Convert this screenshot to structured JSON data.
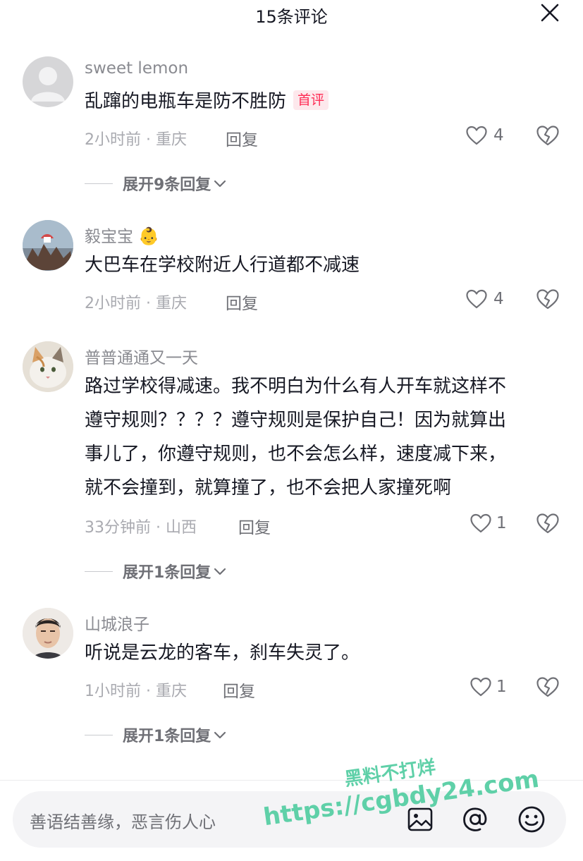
{
  "header": {
    "title": "15条评论"
  },
  "comments": [
    {
      "username": "sweet lemon",
      "text": "乱蹿的电瓶车是防不胜防",
      "badge": "首评",
      "time": "2小时前 · 重庆",
      "reply_label": "回复",
      "likes": "4",
      "expand_label": "展开9条回复"
    },
    {
      "username": "毅宝宝",
      "user_emoji": "👶",
      "text": "大巴车在学校附近人行道都不减速",
      "time": "2小时前 · 重庆",
      "reply_label": "回复",
      "likes": "4"
    },
    {
      "username": "普普通通又一天",
      "text_lines": [
        "路过学校得减速。我不明白为什么有人开车就这样不",
        "遵守规则？？？？遵守规则是保护自己！因为就算出",
        "事儿了，你遵守规则，也不会怎么样，速度减下来，",
        "就不会撞到，就算撞了，也不会把人家撞死啊"
      ],
      "time": "33分钟前 · 山西",
      "reply_label": "回复",
      "likes": "1",
      "expand_label": "展开1条回复"
    },
    {
      "username": "山城浪子",
      "text": "听说是云龙的客车，刹车失灵了。",
      "time": "1小时前 · 重庆",
      "reply_label": "回复",
      "likes": "1",
      "expand_label": "展开1条回复"
    }
  ],
  "input": {
    "placeholder": "善语结善缘，恶言伤人心"
  },
  "watermark": {
    "line1": "黑料不打烊",
    "line2": "https://cgbdy24.com"
  },
  "colors": {
    "accent": "#fe2c55",
    "watermark": "#5fd0a8"
  },
  "icons": [
    "close-icon",
    "heart-icon",
    "broken-heart-icon",
    "chevron-down-icon",
    "image-icon",
    "at-icon",
    "emoji-icon"
  ]
}
